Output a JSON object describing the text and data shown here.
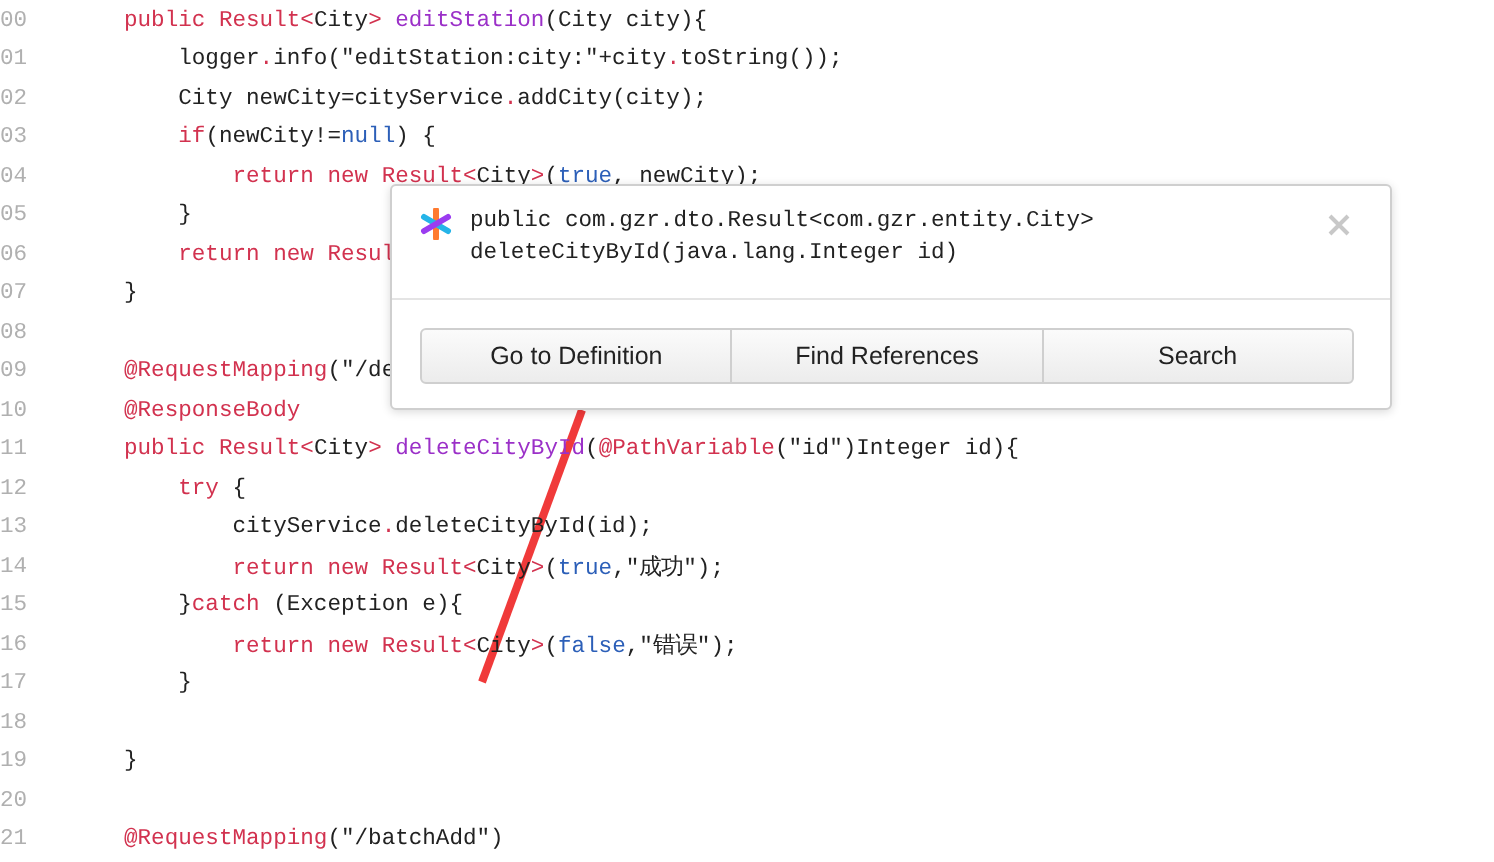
{
  "code_lines": [
    {
      "number": "00",
      "tokens": [
        {
          "text": "public ",
          "kind": "kw"
        },
        {
          "text": "Result",
          "kind": "kw"
        },
        {
          "text": "<",
          "kind": "kw"
        },
        {
          "text": "City",
          "kind": "plain"
        },
        {
          "text": "> ",
          "kind": "kw"
        },
        {
          "text": "editStation",
          "kind": "fn"
        },
        {
          "text": "(City city){",
          "kind": "plain"
        }
      ]
    },
    {
      "number": "01",
      "tokens": [
        {
          "text": "    logger",
          "kind": "plain"
        },
        {
          "text": ".",
          "kind": "kw"
        },
        {
          "text": "info(\"editStation:city:\"+city",
          "kind": "plain"
        },
        {
          "text": ".",
          "kind": "kw"
        },
        {
          "text": "toString());",
          "kind": "plain"
        }
      ]
    },
    {
      "number": "02",
      "tokens": [
        {
          "text": "    City newCity=cityService",
          "kind": "plain"
        },
        {
          "text": ".",
          "kind": "kw"
        },
        {
          "text": "addCity(city);",
          "kind": "plain"
        }
      ]
    },
    {
      "number": "03",
      "tokens": [
        {
          "text": "    if",
          "kind": "kw"
        },
        {
          "text": "(newCity!=",
          "kind": "plain"
        },
        {
          "text": "null",
          "kind": "lit"
        },
        {
          "text": ") {",
          "kind": "plain"
        }
      ]
    },
    {
      "number": "04",
      "tokens": [
        {
          "text": "        return new ",
          "kind": "kw"
        },
        {
          "text": "Result<",
          "kind": "kw"
        },
        {
          "text": "City",
          "kind": "plain"
        },
        {
          "text": ">",
          "kind": "kw"
        },
        {
          "text": "(",
          "kind": "plain"
        },
        {
          "text": "true",
          "kind": "lit"
        },
        {
          "text": ", newCity);",
          "kind": "plain"
        }
      ]
    },
    {
      "number": "05",
      "tokens": [
        {
          "text": "    }",
          "kind": "plain"
        }
      ]
    },
    {
      "number": "06",
      "tokens": [
        {
          "text": "    return new Resul",
          "kind": "kw"
        }
      ]
    },
    {
      "number": "07",
      "tokens": [
        {
          "text": "}",
          "kind": "plain"
        }
      ]
    },
    {
      "number": "08"
    },
    {
      "number": "09",
      "tokens": [
        {
          "text": "@RequestMapping",
          "kind": "kw"
        },
        {
          "text": "(\"/de",
          "kind": "plain"
        }
      ]
    },
    {
      "number": "10",
      "tokens": [
        {
          "text": "@ResponseBody",
          "kind": "kw"
        }
      ]
    },
    {
      "number": "11",
      "tokens": [
        {
          "text": "public ",
          "kind": "kw"
        },
        {
          "text": "Result<",
          "kind": "kw"
        },
        {
          "text": "City",
          "kind": "plain"
        },
        {
          "text": "> ",
          "kind": "kw"
        },
        {
          "text": "deleteCityById",
          "kind": "fn"
        },
        {
          "text": "(",
          "kind": "plain"
        },
        {
          "text": "@PathVariable",
          "kind": "kw"
        },
        {
          "text": "(\"id\")Integer id){",
          "kind": "plain"
        }
      ]
    },
    {
      "number": "12",
      "tokens": [
        {
          "text": "    try",
          "kind": "kw"
        },
        {
          "text": " {",
          "kind": "plain"
        }
      ]
    },
    {
      "number": "13",
      "tokens": [
        {
          "text": "        cityService",
          "kind": "plain"
        },
        {
          "text": ".",
          "kind": "kw"
        },
        {
          "text": "deleteCityById(id);",
          "kind": "plain"
        }
      ]
    },
    {
      "number": "14",
      "tokens": [
        {
          "text": "        return new ",
          "kind": "kw"
        },
        {
          "text": "Result<",
          "kind": "kw"
        },
        {
          "text": "City",
          "kind": "plain"
        },
        {
          "text": ">",
          "kind": "kw"
        },
        {
          "text": "(",
          "kind": "plain"
        },
        {
          "text": "true",
          "kind": "lit"
        },
        {
          "text": ",\"成功\");",
          "kind": "plain"
        }
      ]
    },
    {
      "number": "15",
      "tokens": [
        {
          "text": "    }",
          "kind": "plain"
        },
        {
          "text": "catch",
          "kind": "kw"
        },
        {
          "text": " (Exception e){",
          "kind": "plain"
        }
      ]
    },
    {
      "number": "16",
      "tokens": [
        {
          "text": "        return new ",
          "kind": "kw"
        },
        {
          "text": "Result<",
          "kind": "kw"
        },
        {
          "text": "City",
          "kind": "plain"
        },
        {
          "text": ">",
          "kind": "kw"
        },
        {
          "text": "(",
          "kind": "plain"
        },
        {
          "text": "false",
          "kind": "lit"
        },
        {
          "text": ",\"错误\");",
          "kind": "plain"
        }
      ]
    },
    {
      "number": "17",
      "tokens": [
        {
          "text": "    }",
          "kind": "plain"
        }
      ]
    },
    {
      "number": "18"
    },
    {
      "number": "19",
      "tokens": [
        {
          "text": "}",
          "kind": "plain"
        }
      ]
    },
    {
      "number": "20"
    },
    {
      "number": "21",
      "tokens": [
        {
          "text": "@RequestMapping",
          "kind": "kw"
        },
        {
          "text": "(\"/batchAdd\")",
          "kind": "plain"
        }
      ]
    }
  ],
  "popup": {
    "signature_lines": [
      "public com.gzr.dto.Result<com.gzr.entity.City>",
      "deleteCityById(java.lang.Integer id)"
    ],
    "buttons": [
      "Go to Definition",
      "Find References",
      "Search"
    ]
  }
}
